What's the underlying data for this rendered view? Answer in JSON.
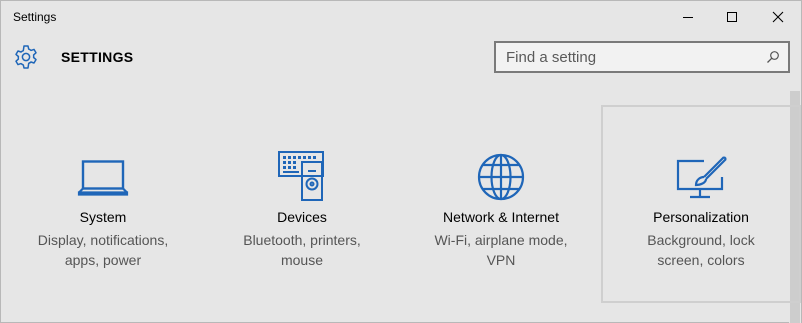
{
  "window": {
    "title": "Settings",
    "controls": {
      "minimize": "minimize",
      "maximize": "maximize",
      "close": "close"
    }
  },
  "header": {
    "icon": "gear-icon",
    "title": "SETTINGS",
    "search": {
      "placeholder": "Find a setting",
      "value": ""
    }
  },
  "colors": {
    "accent": "#1f66b8",
    "background": "#e6e6e6",
    "muted_text": "#555555"
  },
  "tiles": [
    {
      "icon": "laptop-icon",
      "title": "System",
      "desc_line1": "Display, notifications,",
      "desc_line2": "apps, power"
    },
    {
      "icon": "devices-icon",
      "title": "Devices",
      "desc_line1": "Bluetooth, printers,",
      "desc_line2": "mouse"
    },
    {
      "icon": "globe-icon",
      "title": "Network & Internet",
      "desc_line1": "Wi-Fi, airplane mode,",
      "desc_line2": "VPN"
    },
    {
      "icon": "personalization-icon",
      "title": "Personalization",
      "desc_line1": "Background, lock",
      "desc_line2": "screen, colors"
    }
  ]
}
